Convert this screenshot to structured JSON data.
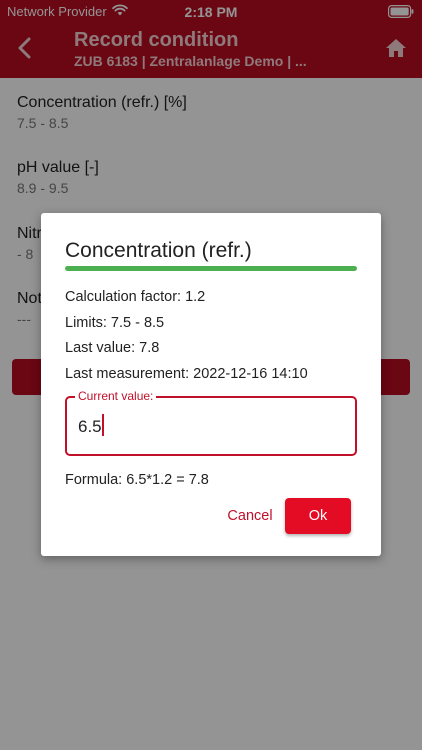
{
  "status_bar": {
    "carrier": "Network Provider",
    "time": "2:18 PM"
  },
  "header": {
    "title": "Record condition",
    "subtitle": "ZUB 6183 | Zentralanlage Demo | ..."
  },
  "form": {
    "fields": [
      {
        "label": "Concentration (refr.) [%]",
        "range": "7.5 - 8.5"
      },
      {
        "label": "pH value [-]",
        "range": "8.9 - 9.5"
      },
      {
        "label": "Nitr",
        "range": "- 8"
      },
      {
        "label": "Not",
        "range": "---"
      }
    ]
  },
  "dialog": {
    "title": "Concentration (refr.)",
    "calculation_factor": "Calculation factor: 1.2",
    "limits": "Limits: 7.5 - 8.5",
    "last_value": "Last value: 7.8",
    "last_measurement": "Last measurement: 2022-12-16 14:10",
    "current_value_label": "Current value:",
    "current_value": "6.5",
    "formula": "Formula: 6.5*1.2 = 7.8",
    "cancel_label": "Cancel",
    "ok_label": "Ok"
  },
  "colors": {
    "brand_red": "#b80c21",
    "accent_red": "#e30c24",
    "divider_green": "#4caf50"
  },
  "icons": {
    "back": "chevron-left-icon",
    "home": "home-icon",
    "wifi": "wifi-icon",
    "battery": "battery-icon"
  }
}
